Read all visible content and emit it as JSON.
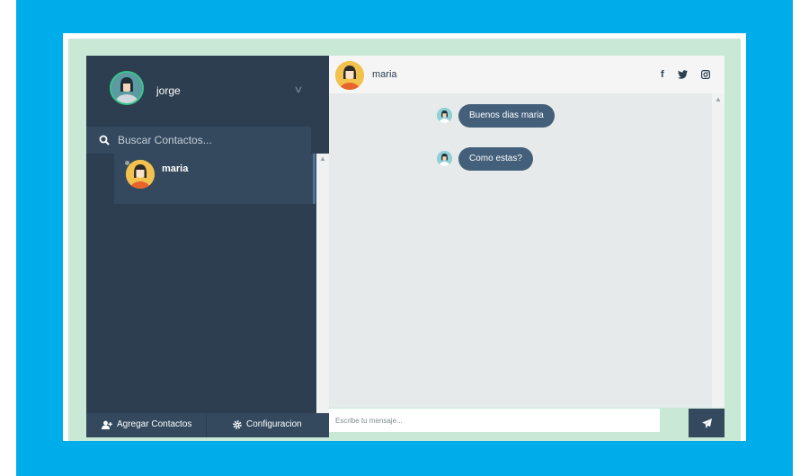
{
  "profile": {
    "name": "jorge",
    "avatar_icon": "user-avatar-icon"
  },
  "search": {
    "placeholder": "Buscar Contactos..."
  },
  "contacts": [
    {
      "name": "maria",
      "status": "offline"
    }
  ],
  "bottom_bar": {
    "add_contacts_label": "Agregar Contactos",
    "settings_label": "Configuracion"
  },
  "chat": {
    "contact_name": "maria",
    "social": {
      "facebook": "f"
    },
    "messages": [
      {
        "text": "Buenos dias maria",
        "sender": "jorge"
      },
      {
        "text": "Como estas?",
        "sender": "jorge"
      }
    ],
    "input_placeholder": "Escribe tu mensaje..."
  },
  "colors": {
    "outer_background": "#00adeb",
    "frame_background": "#c9e9d6",
    "sidebar": "#2c3e50",
    "sidebar_panel": "#34495e",
    "bubble": "#435f7a",
    "messages_background": "#e6eaea",
    "accent_green": "#3cc48b"
  }
}
